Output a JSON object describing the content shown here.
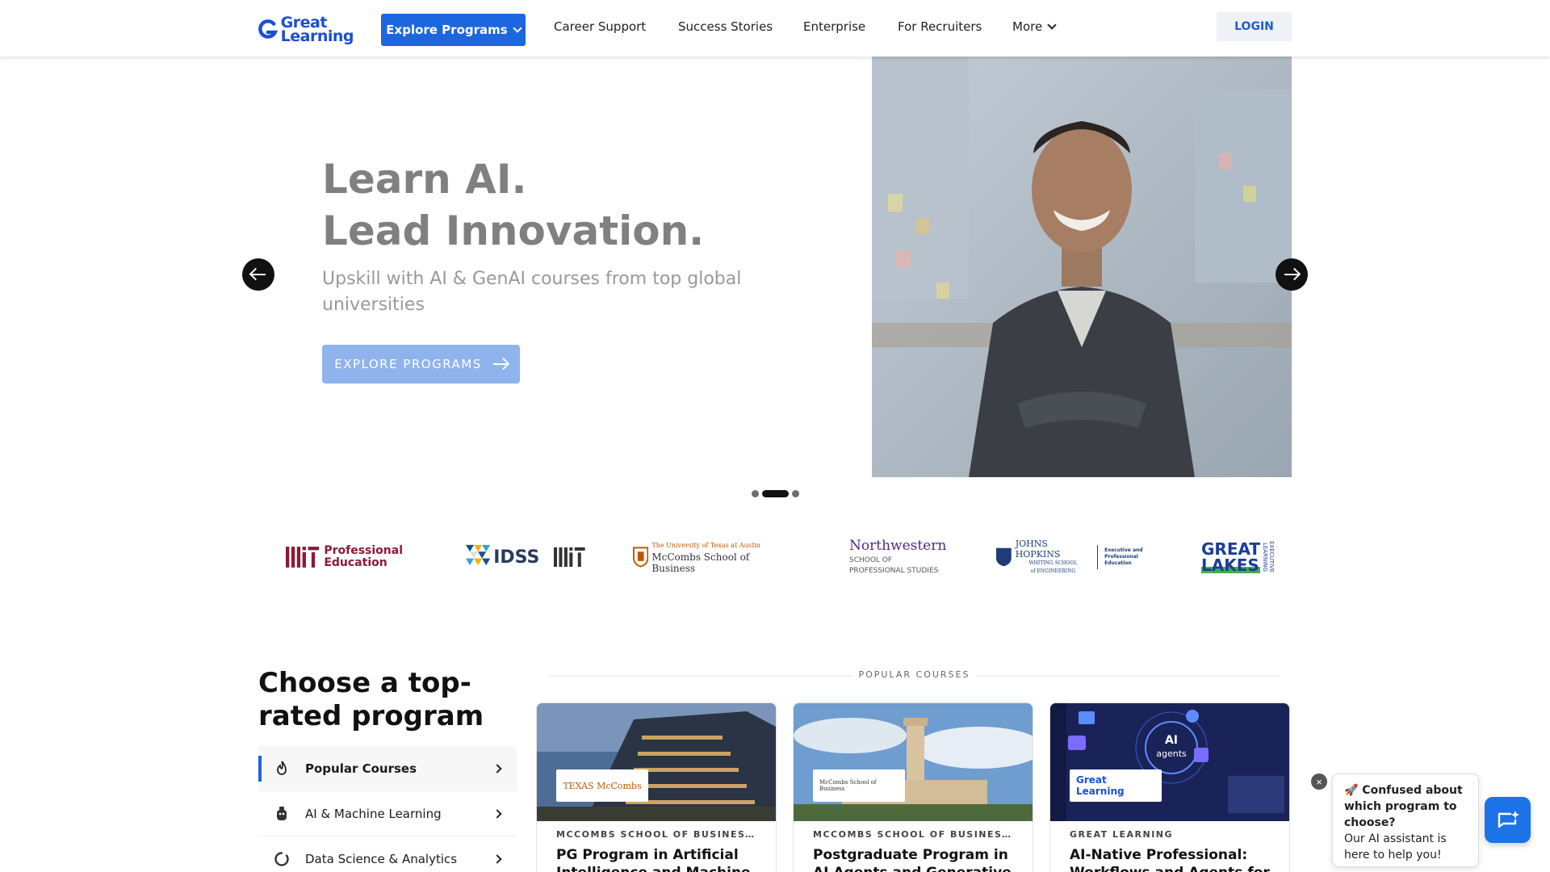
{
  "header": {
    "logo_line1": "Great",
    "logo_line2": "Learning",
    "explore": "Explore Programs",
    "links": [
      "Career Support",
      "Success Stories",
      "Enterprise",
      "For Recruiters",
      "More"
    ],
    "login": "LOGIN"
  },
  "hero": {
    "title_line1": "Learn AI.",
    "title_line2": "Lead Innovation.",
    "subtitle": "Upskill with AI & GenAI courses from top global universities",
    "cta": "EXPLORE PROGRAMS",
    "slide_count": 3,
    "active_slide": 2
  },
  "partners": {
    "mit_pe_line1": "Professional",
    "mit_pe_line2": "Education",
    "idss": "IDSS",
    "mccombs_line1": "The University of Texas at Austin",
    "mccombs_line2": "McCombs School of Business",
    "nw_line1": "Northwestern",
    "nw_line2": "SCHOOL OF",
    "nw_line3": "PROFESSIONAL STUDIES",
    "jhu_line1": "JOHNS HOPKINS",
    "jhu_line2": "WHITING SCHOOL",
    "jhu_line3": "of ENGINEERING",
    "jhu_exec_line1": "Executive and",
    "jhu_exec_line2": "Professional Education",
    "gl_line1": "GREAT",
    "gl_line2": "LAKES",
    "gl_side": "EXECUTIVE LEARNING"
  },
  "programs": {
    "title": "Choose a top-rated program",
    "categories": [
      "Popular Courses",
      "AI & Machine Learning",
      "Data Science & Analytics"
    ],
    "popular_label": "POPULAR COURSES",
    "cards": [
      {
        "org": "MCCOMBS SCHOOL OF BUSINESS AT THE UNIVERSITY OF TEXAS AT AUSTIN",
        "title": "PG Program in Artificial Intelligence and Machine Learning",
        "badge": "TEXAS McCombs"
      },
      {
        "org": "MCCOMBS SCHOOL OF BUSINESS AT THE UNIVERSITY OF TEXAS AT AUSTIN",
        "title": "Postgraduate Program in AI Agents and Generative AI for Business",
        "badge": "McCombs School of Business"
      },
      {
        "org": "GREAT LEARNING",
        "title": "AI-Native Professional: Workflows and Agents for Business",
        "badge": "Great Learning"
      }
    ],
    "ai_agents_label1": "AI",
    "ai_agents_label2": "agents"
  },
  "chat": {
    "heading": "🚀 Confused about which program to choose?",
    "body": "Our AI assistant is here to help you!",
    "close": "×"
  },
  "colors": {
    "brand_blue": "#1c66e0",
    "cta_muted": "#8fb3ec"
  }
}
